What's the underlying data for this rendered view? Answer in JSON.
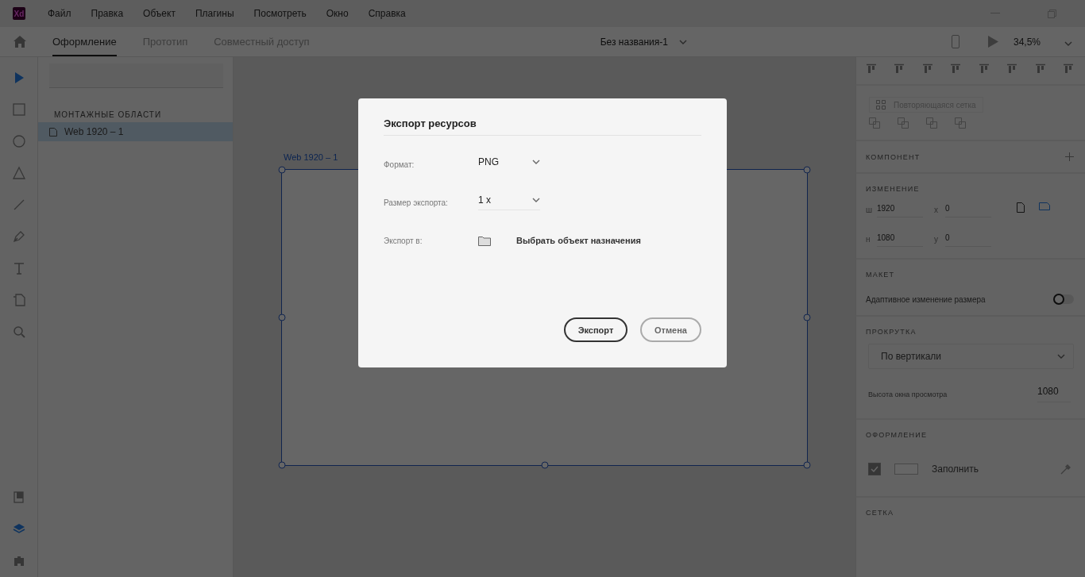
{
  "app": {
    "logo": "Xd"
  },
  "menu": [
    "Файл",
    "Правка",
    "Объект",
    "Плагины",
    "Посмотреть",
    "Окно",
    "Справка"
  ],
  "tabs": [
    {
      "label": "Оформление",
      "selected": true
    },
    {
      "label": "Прототип",
      "selected": false
    },
    {
      "label": "Совместный доступ",
      "selected": false
    }
  ],
  "document_title": "Без названия-1",
  "zoom": "34,5%",
  "tools": [
    {
      "kind": "select",
      "selected": true
    },
    {
      "kind": "rectangle",
      "selected": false
    },
    {
      "kind": "ellipse",
      "selected": false
    },
    {
      "kind": "polygon",
      "selected": false
    },
    {
      "kind": "line",
      "selected": false
    },
    {
      "kind": "pen",
      "selected": false
    },
    {
      "kind": "text",
      "selected": false
    },
    {
      "kind": "artboard",
      "selected": false
    },
    {
      "kind": "zoom",
      "selected": false
    }
  ],
  "panels": [
    {
      "kind": "assets",
      "selected": false
    },
    {
      "kind": "layers",
      "selected": true
    },
    {
      "kind": "plugins",
      "selected": false
    }
  ],
  "layers_panel": {
    "heading": "МОНТАЖНЫЕ ОБЛАСТИ",
    "items": [
      {
        "label": "Web 1920 – 1",
        "selected": true
      }
    ]
  },
  "canvas": {
    "artboard_label": "Web 1920 – 1"
  },
  "inspector": {
    "repeat_grid": "Повторяющаяся сетка",
    "component_heading": "КОМПОНЕНТ",
    "transform_heading": "ИЗМЕНЕНИЕ",
    "fields": [
      {
        "label": "ш",
        "value": "1920"
      },
      {
        "label": "x",
        "value": "0"
      },
      {
        "label": "н",
        "value": "1080"
      },
      {
        "label": "y",
        "value": "0"
      }
    ],
    "layout_heading": "МАКЕТ",
    "responsive_resize": {
      "label": "Адаптивное изменение размера",
      "on": false
    },
    "scroll_heading": "ПРОКРУТКА",
    "scroll_option": "По вертикали",
    "viewport_height": {
      "label": "Высота окна просмотра",
      "value": "1080"
    },
    "appearance_heading": "ОФОРМЛЕНИЕ",
    "fill": {
      "label": "Заполнить",
      "checked": true
    },
    "grid_heading": "СЕТКА"
  },
  "dialog": {
    "title": "Экспорт ресурсов",
    "rows": [
      {
        "kind": "dropdown",
        "label": "Формат:",
        "value": "PNG"
      },
      {
        "kind": "dropdown",
        "label": "Размер экспорта:",
        "value": "1 x"
      },
      {
        "kind": "destination",
        "label": "Экспорт в:",
        "value": "Выбрать объект назначения"
      }
    ],
    "buttons": [
      {
        "kind": "primary",
        "label": "Экспорт"
      },
      {
        "kind": "secondary",
        "label": "Отмена"
      }
    ]
  }
}
